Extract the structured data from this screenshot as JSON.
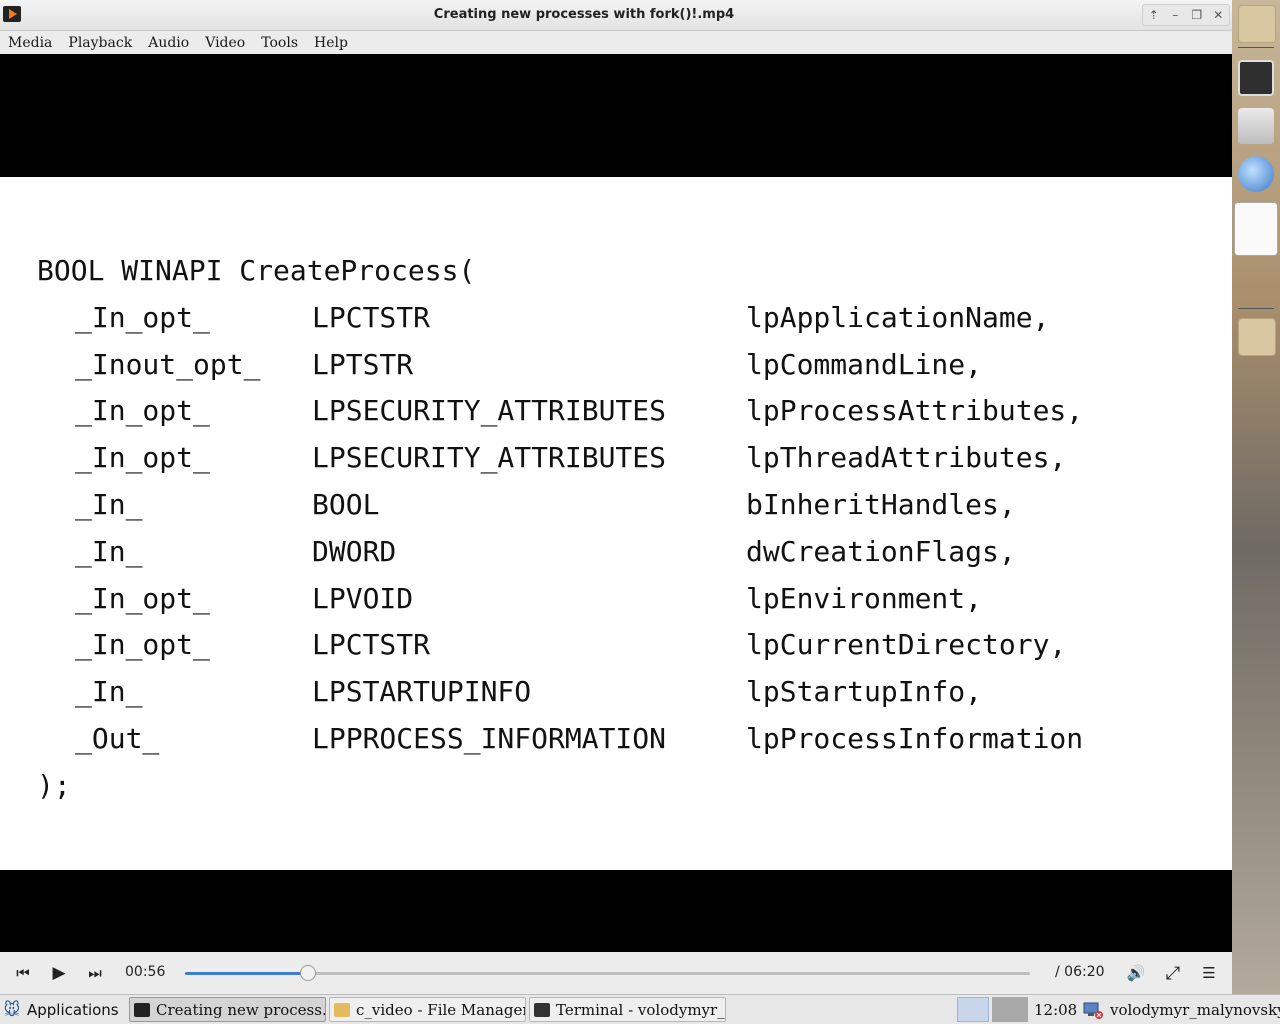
{
  "window": {
    "title": "Creating new processes with fork()!.mp4",
    "controls": [
      "⇡",
      "–",
      "❐",
      "✕"
    ]
  },
  "menu": [
    "Media",
    "Playback",
    "Audio",
    "Video",
    "Tools",
    "Help"
  ],
  "slide": {
    "lines": [
      [
        "BOOL WINAPI CreateProcess(",
        "",
        "",
        ""
      ],
      [
        "",
        "_In_opt_",
        "LPCTSTR",
        "lpApplicationName,"
      ],
      [
        "",
        "_Inout_opt_",
        "LPTSTR",
        "lpCommandLine,"
      ],
      [
        "",
        "_In_opt_",
        "LPSECURITY_ATTRIBUTES",
        "lpProcessAttributes,"
      ],
      [
        "",
        "_In_opt_",
        "LPSECURITY_ATTRIBUTES",
        "lpThreadAttributes,"
      ],
      [
        "",
        "_In_",
        "BOOL",
        "bInheritHandles,"
      ],
      [
        "",
        "_In_",
        "DWORD",
        "dwCreationFlags,"
      ],
      [
        "",
        "_In_opt_",
        "LPVOID",
        "lpEnvironment,"
      ],
      [
        "",
        "_In_opt_",
        "LPCTSTR",
        "lpCurrentDirectory,"
      ],
      [
        "",
        "_In_",
        "LPSTARTUPINFO",
        "lpStartupInfo,"
      ],
      [
        "",
        "_Out_",
        "LPPROCESS_INFORMATION",
        "lpProcessInformation"
      ],
      [
        ");",
        "",
        "",
        ""
      ]
    ]
  },
  "player": {
    "elapsed": "00:56",
    "total": "/ 06:20",
    "progress_fraction": 0.146,
    "icons": {
      "prev": "⏮",
      "play": "▶",
      "next": "⏭",
      "volume": "🔊",
      "fullscreen": "⤢",
      "playlist": "☰"
    }
  },
  "taskbar": {
    "applications_label": "Applications",
    "tasks": [
      {
        "label": "Creating new process...",
        "icon": "vlc-icon",
        "active": true
      },
      {
        "label": "c_video - File Manager",
        "icon": "folder-icon",
        "active": false
      },
      {
        "label": "Terminal - volodymyr_...",
        "icon": "terminal-icon",
        "active": false
      }
    ],
    "clock": "12:08",
    "user": "volodymyr_malynovskyi"
  }
}
